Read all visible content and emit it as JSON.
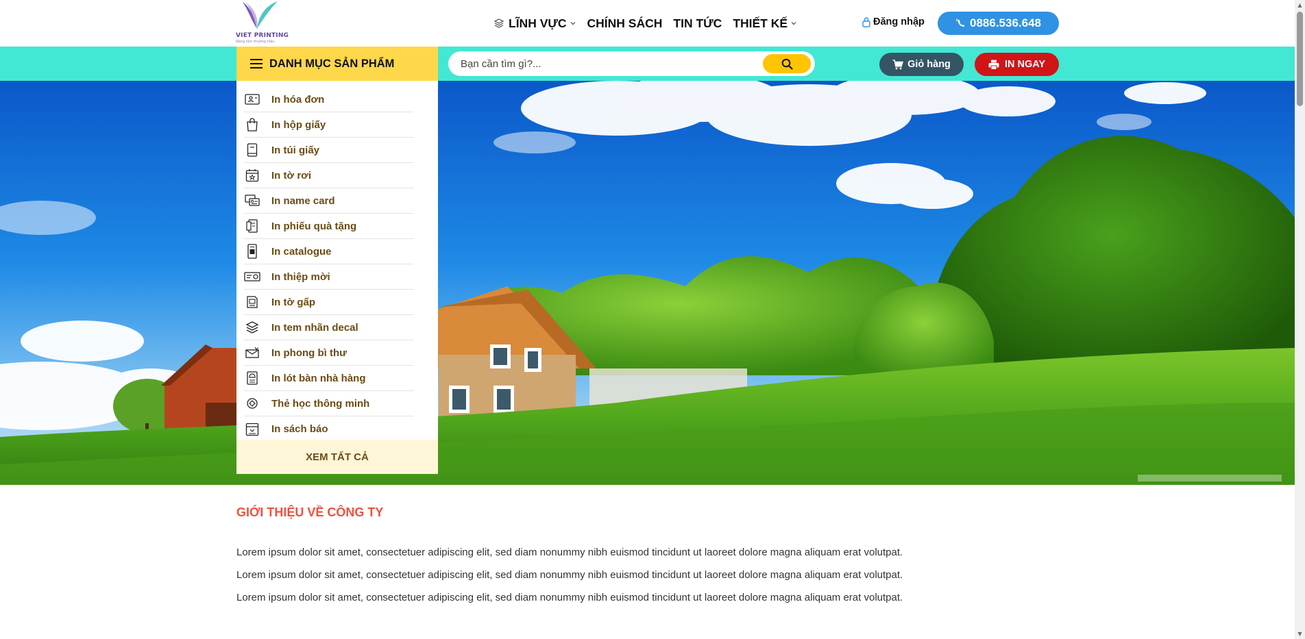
{
  "logo": {
    "brand": "VIET PRINTING",
    "tagline": "Nâng tầm thương hiệu",
    "colors": {
      "purple": "#7b5cb8",
      "teal": "#4fc7c1"
    }
  },
  "nav": {
    "items": [
      {
        "label": "LĨNH VỰC",
        "icon": "layers-icon",
        "dropdown": true
      },
      {
        "label": "CHÍNH SÁCH",
        "dropdown": false
      },
      {
        "label": "TIN TỨC",
        "dropdown": false
      },
      {
        "label": "THIẾT KẾ",
        "dropdown": true
      }
    ]
  },
  "header": {
    "login_label": "Đăng nhập",
    "phone_label": "0886.536.648"
  },
  "category_bar": {
    "title": "DANH MỤC SẢN PHẨM",
    "bg_color": "#42e8d4",
    "title_bg_color": "#ffd74a"
  },
  "search": {
    "placeholder": "Bạn cần tìm gì?..."
  },
  "buttons": {
    "cart_label": "Giỏ hàng",
    "print_label": "IN NGAY"
  },
  "categories": {
    "items": [
      {
        "label": "In hóa đơn",
        "icon": "id-card-icon"
      },
      {
        "label": "In hộp giấy",
        "icon": "shopping-bag-icon"
      },
      {
        "label": "In túi giấy",
        "icon": "book-icon"
      },
      {
        "label": "In tờ rơi",
        "icon": "calendar-star-icon"
      },
      {
        "label": "In name card",
        "icon": "business-card-icon"
      },
      {
        "label": "In phiếu quà tặng",
        "icon": "gift-voucher-icon"
      },
      {
        "label": "In catalogue",
        "icon": "catalogue-icon"
      },
      {
        "label": "In thiệp mời",
        "icon": "invitation-card-icon"
      },
      {
        "label": "In tờ gấp",
        "icon": "folded-leaflet-icon"
      },
      {
        "label": "In tem nhãn decal",
        "icon": "label-stack-icon"
      },
      {
        "label": "In phong bì thư",
        "icon": "envelope-icon"
      },
      {
        "label": "In lót bàn nhà hàng",
        "icon": "placemat-icon"
      },
      {
        "label": "Thẻ học thông minh",
        "icon": "smart-card-icon"
      },
      {
        "label": "In sách báo",
        "icon": "newspaper-icon"
      }
    ],
    "view_all": "XEM TẤT CẢ"
  },
  "about": {
    "title": "GIỚI THIỆU VỀ CÔNG TY",
    "paragraphs": [
      "Lorem ipsum dolor sit amet, consectetuer adipiscing elit, sed diam nonummy nibh euismod tincidunt ut laoreet dolore magna aliquam erat volutpat.",
      "Lorem ipsum dolor sit amet, consectetuer adipiscing elit, sed diam nonummy nibh euismod tincidunt ut laoreet dolore magna aliquam erat volutpat.",
      "Lorem ipsum dolor sit amet, consectetuer adipiscing elit, sed diam nonummy nibh euismod tincidunt ut laoreet dolore magna aliquam erat volutpat."
    ]
  },
  "colors": {
    "accent_red": "#d01418",
    "accent_blue": "#2f92e2",
    "heading_red": "#f0503c",
    "cart_dark": "#335565",
    "menu_text": "#6b4b14"
  }
}
